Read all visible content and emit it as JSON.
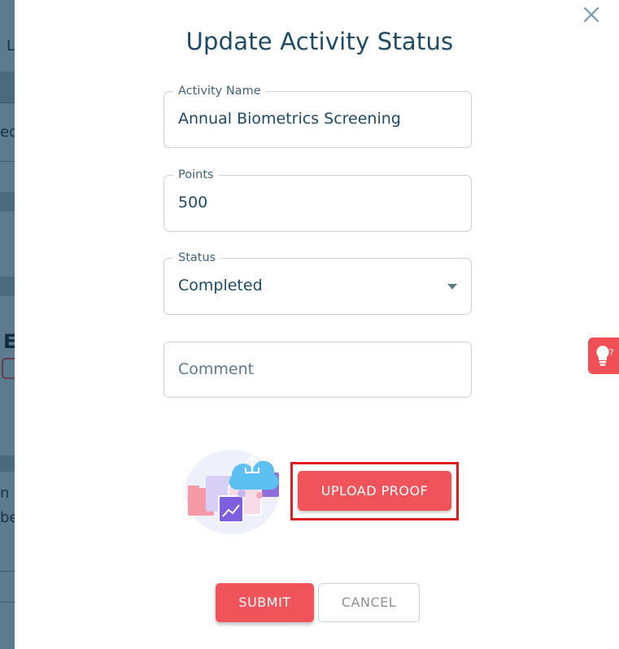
{
  "background": {
    "fragments": [
      "L",
      "ed",
      "E",
      "n c",
      "be"
    ]
  },
  "modal": {
    "title": "Update Activity Status",
    "fields": {
      "activity_name": {
        "label": "Activity Name",
        "value": "Annual Biometrics Screening"
      },
      "points": {
        "label": "Points",
        "value": "500"
      },
      "status": {
        "label": "Status",
        "value": "Completed"
      },
      "comment": {
        "placeholder": "Comment"
      }
    },
    "upload_label": "UPLOAD PROOF",
    "submit_label": "SUBMIT",
    "cancel_label": "CANCEL"
  },
  "help": {
    "badge": "?"
  },
  "colors": {
    "accent": "#f0545a",
    "highlight_frame": "#e11d24",
    "title": "#1d4a66",
    "overlay": "#4f7186"
  },
  "icons": {
    "close": "close-icon",
    "dropdown": "chevron-down-icon",
    "help": "lightbulb-icon",
    "illustration": "cloud-upload-icon"
  }
}
